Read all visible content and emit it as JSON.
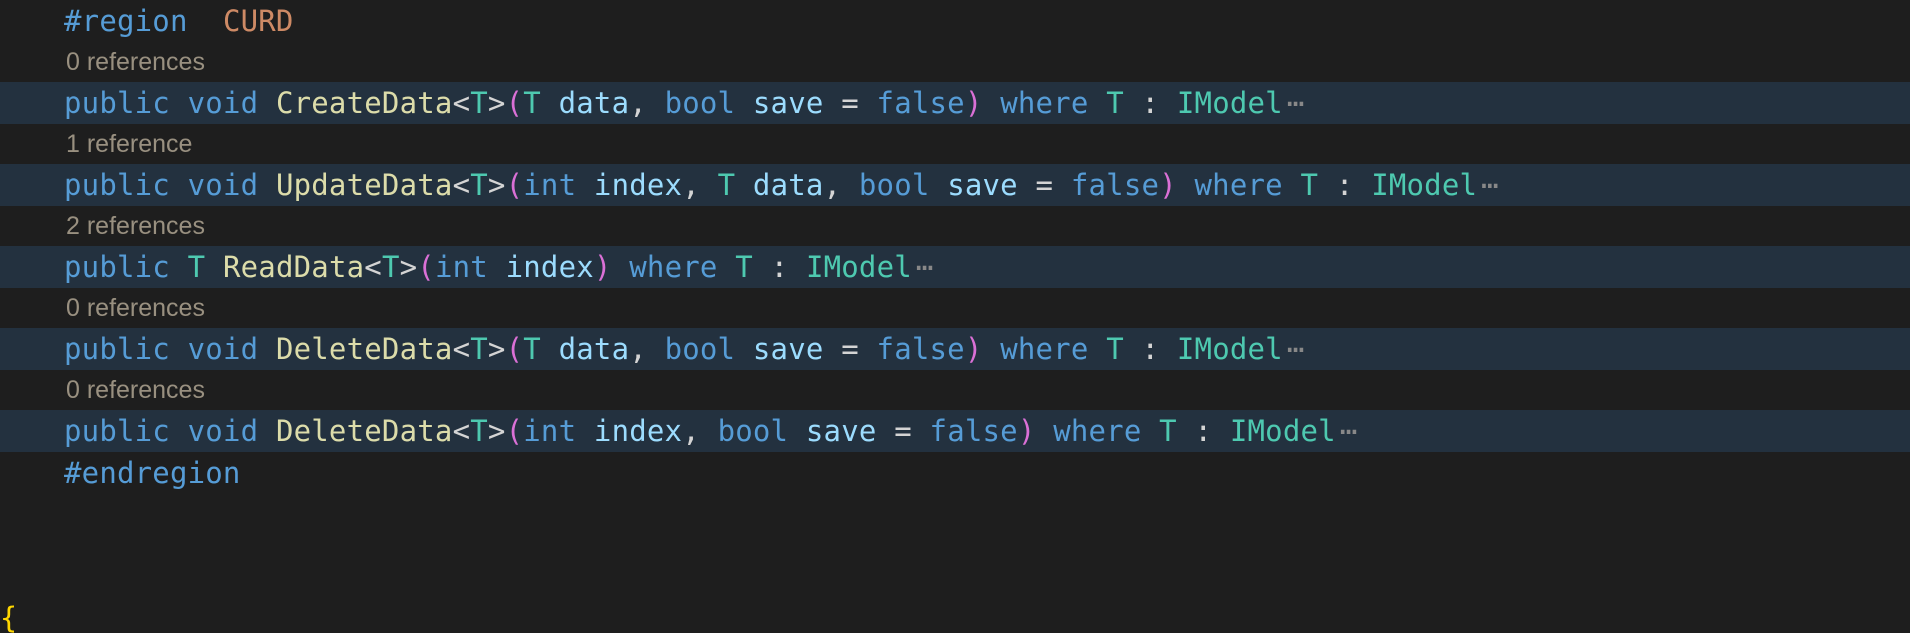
{
  "editor": {
    "language": "csharp",
    "background_color": "#1E1E1E",
    "folded_line_color": "#23313F",
    "codelens_color": "#999080",
    "colors": {
      "keyword": "#569CD6",
      "method": "#DCDCAA",
      "type": "#4EC9B0",
      "parameter": "#9CDCFE",
      "plain": "#D4D4D4",
      "bracket": "#DA70D6",
      "preprocessor": "#569CD6",
      "region_name": "#CE8A65",
      "fold_marker": "#888888"
    },
    "fold_marker": "⋯",
    "bottom_bracket_glyph": "{"
  },
  "lines": [
    {
      "kind": "code",
      "folded": false,
      "text": "#region  CURD",
      "tokens": [
        {
          "text": "#region",
          "cls": "t-pp"
        },
        {
          "text": "  ",
          "cls": "t-plain"
        },
        {
          "text": "CURD",
          "cls": "t-ppname"
        }
      ]
    },
    {
      "kind": "codelens",
      "text": "0 references"
    },
    {
      "kind": "code",
      "folded": true,
      "text": "public void CreateData<T>(T data, bool save = false) where T : IModel",
      "fold": true,
      "tokens": [
        {
          "text": "public",
          "cls": "t-kw"
        },
        {
          "text": " ",
          "cls": "t-plain"
        },
        {
          "text": "void",
          "cls": "t-kw"
        },
        {
          "text": " ",
          "cls": "t-plain"
        },
        {
          "text": "CreateData",
          "cls": "t-method"
        },
        {
          "text": "<",
          "cls": "t-angle"
        },
        {
          "text": "T",
          "cls": "t-type"
        },
        {
          "text": ">",
          "cls": "t-angle"
        },
        {
          "text": "(",
          "cls": "t-paren"
        },
        {
          "text": "T",
          "cls": "t-type"
        },
        {
          "text": " ",
          "cls": "t-plain"
        },
        {
          "text": "data",
          "cls": "t-param"
        },
        {
          "text": ",",
          "cls": "t-comma"
        },
        {
          "text": " ",
          "cls": "t-plain"
        },
        {
          "text": "bool",
          "cls": "t-kw"
        },
        {
          "text": " ",
          "cls": "t-plain"
        },
        {
          "text": "save",
          "cls": "t-param"
        },
        {
          "text": " ",
          "cls": "t-plain"
        },
        {
          "text": "=",
          "cls": "t-plain"
        },
        {
          "text": " ",
          "cls": "t-plain"
        },
        {
          "text": "false",
          "cls": "t-kw"
        },
        {
          "text": ")",
          "cls": "t-paren"
        },
        {
          "text": " ",
          "cls": "t-plain"
        },
        {
          "text": "where",
          "cls": "t-kw"
        },
        {
          "text": " ",
          "cls": "t-plain"
        },
        {
          "text": "T",
          "cls": "t-type"
        },
        {
          "text": " ",
          "cls": "t-plain"
        },
        {
          "text": ":",
          "cls": "t-colon"
        },
        {
          "text": " ",
          "cls": "t-plain"
        },
        {
          "text": "IModel",
          "cls": "t-type"
        }
      ]
    },
    {
      "kind": "codelens",
      "text": "1 reference"
    },
    {
      "kind": "code",
      "folded": true,
      "text": "public void UpdateData<T>(int index, T data, bool save = false) where T : IModel",
      "fold": true,
      "tokens": [
        {
          "text": "public",
          "cls": "t-kw"
        },
        {
          "text": " ",
          "cls": "t-plain"
        },
        {
          "text": "void",
          "cls": "t-kw"
        },
        {
          "text": " ",
          "cls": "t-plain"
        },
        {
          "text": "UpdateData",
          "cls": "t-method"
        },
        {
          "text": "<",
          "cls": "t-angle"
        },
        {
          "text": "T",
          "cls": "t-type"
        },
        {
          "text": ">",
          "cls": "t-angle"
        },
        {
          "text": "(",
          "cls": "t-paren"
        },
        {
          "text": "int",
          "cls": "t-kw"
        },
        {
          "text": " ",
          "cls": "t-plain"
        },
        {
          "text": "index",
          "cls": "t-param"
        },
        {
          "text": ",",
          "cls": "t-comma"
        },
        {
          "text": " ",
          "cls": "t-plain"
        },
        {
          "text": "T",
          "cls": "t-type"
        },
        {
          "text": " ",
          "cls": "t-plain"
        },
        {
          "text": "data",
          "cls": "t-param"
        },
        {
          "text": ",",
          "cls": "t-comma"
        },
        {
          "text": " ",
          "cls": "t-plain"
        },
        {
          "text": "bool",
          "cls": "t-kw"
        },
        {
          "text": " ",
          "cls": "t-plain"
        },
        {
          "text": "save",
          "cls": "t-param"
        },
        {
          "text": " ",
          "cls": "t-plain"
        },
        {
          "text": "=",
          "cls": "t-plain"
        },
        {
          "text": " ",
          "cls": "t-plain"
        },
        {
          "text": "false",
          "cls": "t-kw"
        },
        {
          "text": ")",
          "cls": "t-paren"
        },
        {
          "text": " ",
          "cls": "t-plain"
        },
        {
          "text": "where",
          "cls": "t-kw"
        },
        {
          "text": " ",
          "cls": "t-plain"
        },
        {
          "text": "T",
          "cls": "t-type"
        },
        {
          "text": " ",
          "cls": "t-plain"
        },
        {
          "text": ":",
          "cls": "t-colon"
        },
        {
          "text": " ",
          "cls": "t-plain"
        },
        {
          "text": "IModel",
          "cls": "t-type"
        }
      ]
    },
    {
      "kind": "codelens",
      "text": "2 references"
    },
    {
      "kind": "code",
      "folded": true,
      "text": "public T ReadData<T>(int index) where T : IModel",
      "fold": true,
      "tokens": [
        {
          "text": "public",
          "cls": "t-kw"
        },
        {
          "text": " ",
          "cls": "t-plain"
        },
        {
          "text": "T",
          "cls": "t-type"
        },
        {
          "text": " ",
          "cls": "t-plain"
        },
        {
          "text": "ReadData",
          "cls": "t-method"
        },
        {
          "text": "<",
          "cls": "t-angle"
        },
        {
          "text": "T",
          "cls": "t-type"
        },
        {
          "text": ">",
          "cls": "t-angle"
        },
        {
          "text": "(",
          "cls": "t-paren"
        },
        {
          "text": "int",
          "cls": "t-kw"
        },
        {
          "text": " ",
          "cls": "t-plain"
        },
        {
          "text": "index",
          "cls": "t-param"
        },
        {
          "text": ")",
          "cls": "t-paren"
        },
        {
          "text": " ",
          "cls": "t-plain"
        },
        {
          "text": "where",
          "cls": "t-kw"
        },
        {
          "text": " ",
          "cls": "t-plain"
        },
        {
          "text": "T",
          "cls": "t-type"
        },
        {
          "text": " ",
          "cls": "t-plain"
        },
        {
          "text": ":",
          "cls": "t-colon"
        },
        {
          "text": " ",
          "cls": "t-plain"
        },
        {
          "text": "IModel",
          "cls": "t-type"
        }
      ]
    },
    {
      "kind": "codelens",
      "text": "0 references"
    },
    {
      "kind": "code",
      "folded": true,
      "text": "public void DeleteData<T>(T data, bool save = false) where T : IModel",
      "fold": true,
      "tokens": [
        {
          "text": "public",
          "cls": "t-kw"
        },
        {
          "text": " ",
          "cls": "t-plain"
        },
        {
          "text": "void",
          "cls": "t-kw"
        },
        {
          "text": " ",
          "cls": "t-plain"
        },
        {
          "text": "DeleteData",
          "cls": "t-method"
        },
        {
          "text": "<",
          "cls": "t-angle"
        },
        {
          "text": "T",
          "cls": "t-type"
        },
        {
          "text": ">",
          "cls": "t-angle"
        },
        {
          "text": "(",
          "cls": "t-paren"
        },
        {
          "text": "T",
          "cls": "t-type"
        },
        {
          "text": " ",
          "cls": "t-plain"
        },
        {
          "text": "data",
          "cls": "t-param"
        },
        {
          "text": ",",
          "cls": "t-comma"
        },
        {
          "text": " ",
          "cls": "t-plain"
        },
        {
          "text": "bool",
          "cls": "t-kw"
        },
        {
          "text": " ",
          "cls": "t-plain"
        },
        {
          "text": "save",
          "cls": "t-param"
        },
        {
          "text": " ",
          "cls": "t-plain"
        },
        {
          "text": "=",
          "cls": "t-plain"
        },
        {
          "text": " ",
          "cls": "t-plain"
        },
        {
          "text": "false",
          "cls": "t-kw"
        },
        {
          "text": ")",
          "cls": "t-paren"
        },
        {
          "text": " ",
          "cls": "t-plain"
        },
        {
          "text": "where",
          "cls": "t-kw"
        },
        {
          "text": " ",
          "cls": "t-plain"
        },
        {
          "text": "T",
          "cls": "t-type"
        },
        {
          "text": " ",
          "cls": "t-plain"
        },
        {
          "text": ":",
          "cls": "t-colon"
        },
        {
          "text": " ",
          "cls": "t-plain"
        },
        {
          "text": "IModel",
          "cls": "t-type"
        }
      ]
    },
    {
      "kind": "codelens",
      "text": "0 references"
    },
    {
      "kind": "code",
      "folded": true,
      "text": "public void DeleteData<T>(int index, bool save = false) where T : IModel",
      "fold": true,
      "tokens": [
        {
          "text": "public",
          "cls": "t-kw"
        },
        {
          "text": " ",
          "cls": "t-plain"
        },
        {
          "text": "void",
          "cls": "t-kw"
        },
        {
          "text": " ",
          "cls": "t-plain"
        },
        {
          "text": "DeleteData",
          "cls": "t-method"
        },
        {
          "text": "<",
          "cls": "t-angle"
        },
        {
          "text": "T",
          "cls": "t-type"
        },
        {
          "text": ">",
          "cls": "t-angle"
        },
        {
          "text": "(",
          "cls": "t-paren"
        },
        {
          "text": "int",
          "cls": "t-kw"
        },
        {
          "text": " ",
          "cls": "t-plain"
        },
        {
          "text": "index",
          "cls": "t-param"
        },
        {
          "text": ",",
          "cls": "t-comma"
        },
        {
          "text": " ",
          "cls": "t-plain"
        },
        {
          "text": "bool",
          "cls": "t-kw"
        },
        {
          "text": " ",
          "cls": "t-plain"
        },
        {
          "text": "save",
          "cls": "t-param"
        },
        {
          "text": " ",
          "cls": "t-plain"
        },
        {
          "text": "=",
          "cls": "t-plain"
        },
        {
          "text": " ",
          "cls": "t-plain"
        },
        {
          "text": "false",
          "cls": "t-kw"
        },
        {
          "text": ")",
          "cls": "t-paren"
        },
        {
          "text": " ",
          "cls": "t-plain"
        },
        {
          "text": "where",
          "cls": "t-kw"
        },
        {
          "text": " ",
          "cls": "t-plain"
        },
        {
          "text": "T",
          "cls": "t-type"
        },
        {
          "text": " ",
          "cls": "t-plain"
        },
        {
          "text": ":",
          "cls": "t-colon"
        },
        {
          "text": " ",
          "cls": "t-plain"
        },
        {
          "text": "IModel",
          "cls": "t-type"
        }
      ]
    },
    {
      "kind": "code",
      "folded": false,
      "text": "#endregion",
      "tokens": [
        {
          "text": "#endregion",
          "cls": "t-pp"
        }
      ]
    }
  ]
}
